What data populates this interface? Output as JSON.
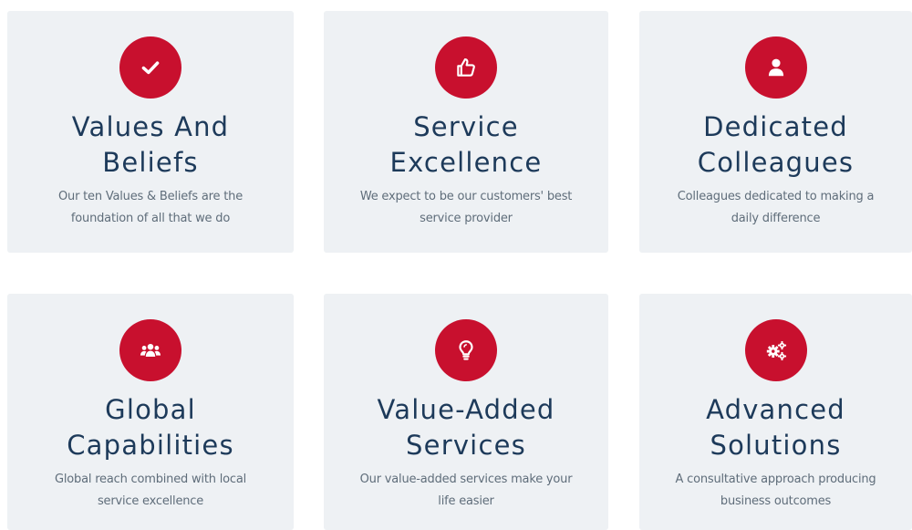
{
  "colors": {
    "accent": "#c8102e",
    "card_background": "#eef1f4",
    "title": "#1d3a5a",
    "description": "#5f6d7a"
  },
  "cards": [
    {
      "icon": "check-icon",
      "title_line1": "Values And",
      "title_line2": "Beliefs",
      "desc_line1": "Our ten Values & Beliefs are the",
      "desc_line2": "foundation of all that we do"
    },
    {
      "icon": "thumbs-up-icon",
      "title_line1": "Service",
      "title_line2": "Excellence",
      "desc_line1": "We expect to be our customers' best",
      "desc_line2": "service provider"
    },
    {
      "icon": "user-icon",
      "title_line1": "Dedicated",
      "title_line2": "Colleagues",
      "desc_line1": "Colleagues dedicated to making a",
      "desc_line2": "daily difference"
    },
    {
      "icon": "users-group-icon",
      "title_line1": "Global",
      "title_line2": "Capabilities",
      "desc_line1": "Global reach combined with local",
      "desc_line2": "service excellence"
    },
    {
      "icon": "lightbulb-icon",
      "title_line1": "Value-Added",
      "title_line2": "Services",
      "desc_line1": "Our value-added services make your",
      "desc_line2": "life easier"
    },
    {
      "icon": "gears-icon",
      "title_line1": "Advanced",
      "title_line2": "Solutions",
      "desc_line1": "A consultative approach producing",
      "desc_line2": "business outcomes"
    }
  ]
}
